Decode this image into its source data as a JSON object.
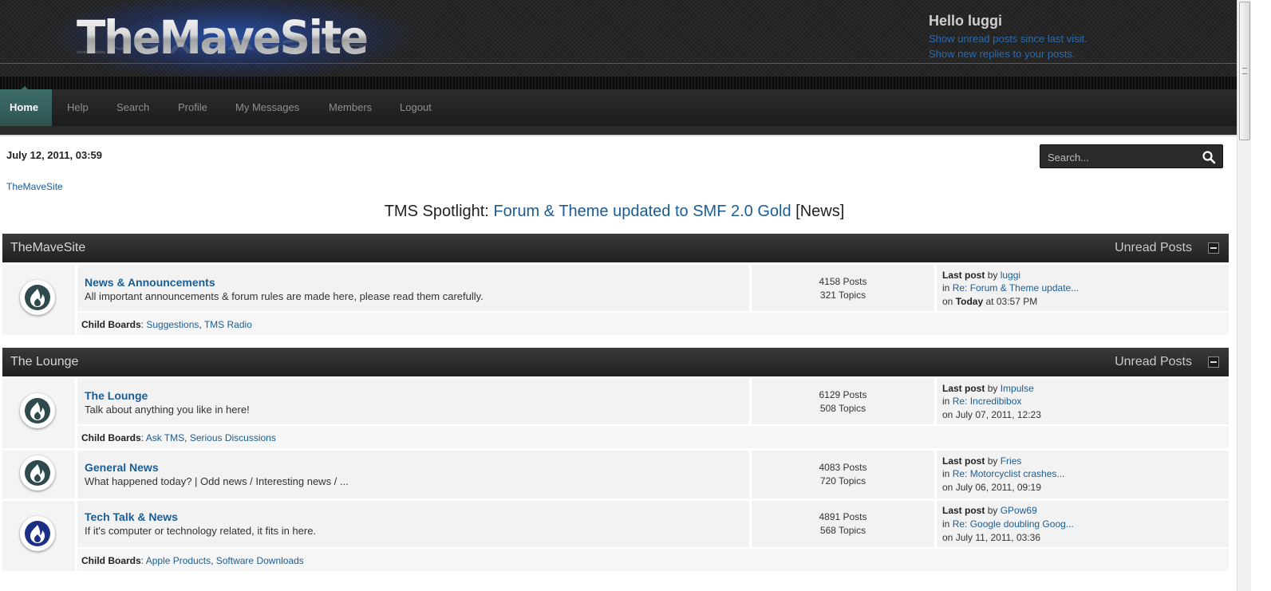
{
  "header": {
    "logo_text": "TheMaveSite",
    "greeting": "Hello luggi",
    "links": [
      "Show unread posts since last visit.",
      "Show new replies to your posts."
    ]
  },
  "nav": {
    "items": [
      "Home",
      "Help",
      "Search",
      "Profile",
      "My Messages",
      "Members",
      "Logout"
    ],
    "active": "Home"
  },
  "date": "July 12, 2011, 03:59",
  "search": {
    "placeholder": "Search..."
  },
  "breadcrumb": "TheMaveSite",
  "spotlight": {
    "prefix": "TMS Spotlight:",
    "link": "Forum & Theme updated to SMF 2.0 Gold",
    "tag": "[News]"
  },
  "categories": [
    {
      "title": "TheMaveSite",
      "unread_label": "Unread Posts",
      "boards": [
        {
          "name": "News & Announcements",
          "description": "All important announcements & forum rules are made here, please read them carefully.",
          "posts": "4158 Posts",
          "topics": "321 Topics",
          "last_post_label": "Last post",
          "by_label": "by",
          "last_user": "luggi",
          "in_label": "in",
          "last_topic": "Re: Forum & Theme update...",
          "on_label": "on",
          "last_date_bold": "Today",
          "last_date_rest": "at 03:57 PM",
          "child_label": "Child Boards",
          "children": [
            "Suggestions",
            "TMS Radio"
          ],
          "icon_color": "#2f4a4c"
        }
      ]
    },
    {
      "title": "The Lounge",
      "unread_label": "Unread Posts",
      "boards": [
        {
          "name": "The Lounge",
          "description": "Talk about anything you like in here!",
          "posts": "6129 Posts",
          "topics": "508 Topics",
          "last_post_label": "Last post",
          "by_label": "by",
          "last_user": "Impulse",
          "in_label": "in",
          "last_topic": "Re: Incredibibox",
          "on_label": "on",
          "last_date": "July 07, 2011, 12:23",
          "child_label": "Child Boards",
          "children": [
            "Ask TMS",
            "Serious Discussions"
          ],
          "icon_color": "#2f4a4c"
        },
        {
          "name": "General News",
          "description": "What happened today? | Odd news / Interesting news / ...",
          "posts": "4083 Posts",
          "topics": "720 Topics",
          "last_post_label": "Last post",
          "by_label": "by",
          "last_user": "Fries",
          "in_label": "in",
          "last_topic": "Re: Motorcyclist crashes...",
          "on_label": "on",
          "last_date": "July 06, 2011, 09:19",
          "icon_color": "#2f4a4c"
        },
        {
          "name": "Tech Talk & News",
          "description": "If it's computer or technology related, it fits in here.",
          "posts": "4891 Posts",
          "topics": "568 Topics",
          "last_post_label": "Last post",
          "by_label": "by",
          "last_user": "GPow69",
          "in_label": "in",
          "last_topic": "Re: Google doubling Goog...",
          "on_label": "on",
          "last_date": "July 11, 2011, 03:36",
          "child_label": "Child Boards",
          "children": [
            "Apple Products",
            "Software Downloads"
          ],
          "icon_color": "#1c2f86"
        }
      ]
    }
  ]
}
